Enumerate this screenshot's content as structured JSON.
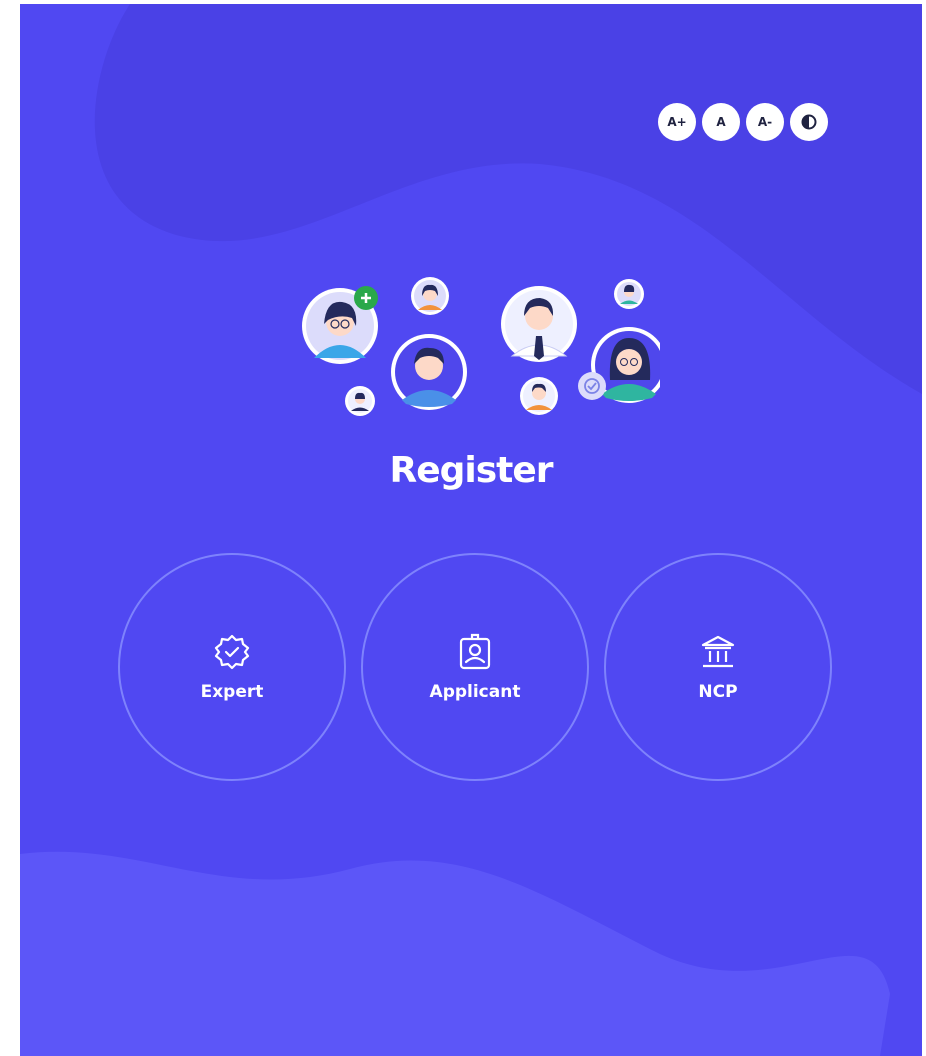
{
  "accessibility": {
    "increase_text": "A+",
    "default_text": "A",
    "decrease_text": "A-"
  },
  "page": {
    "title": "Register"
  },
  "roles": [
    {
      "label": "Expert",
      "icon": "badge-check-icon"
    },
    {
      "label": "Applicant",
      "icon": "id-badge-icon"
    },
    {
      "label": "NCP",
      "icon": "institution-icon"
    }
  ],
  "colors": {
    "background": "#5048f2",
    "wave_top": "#4a41e6",
    "wave_bottom": "#5c56f8",
    "badge_green": "#2aa84a",
    "circle_border": "#8e96ff"
  }
}
